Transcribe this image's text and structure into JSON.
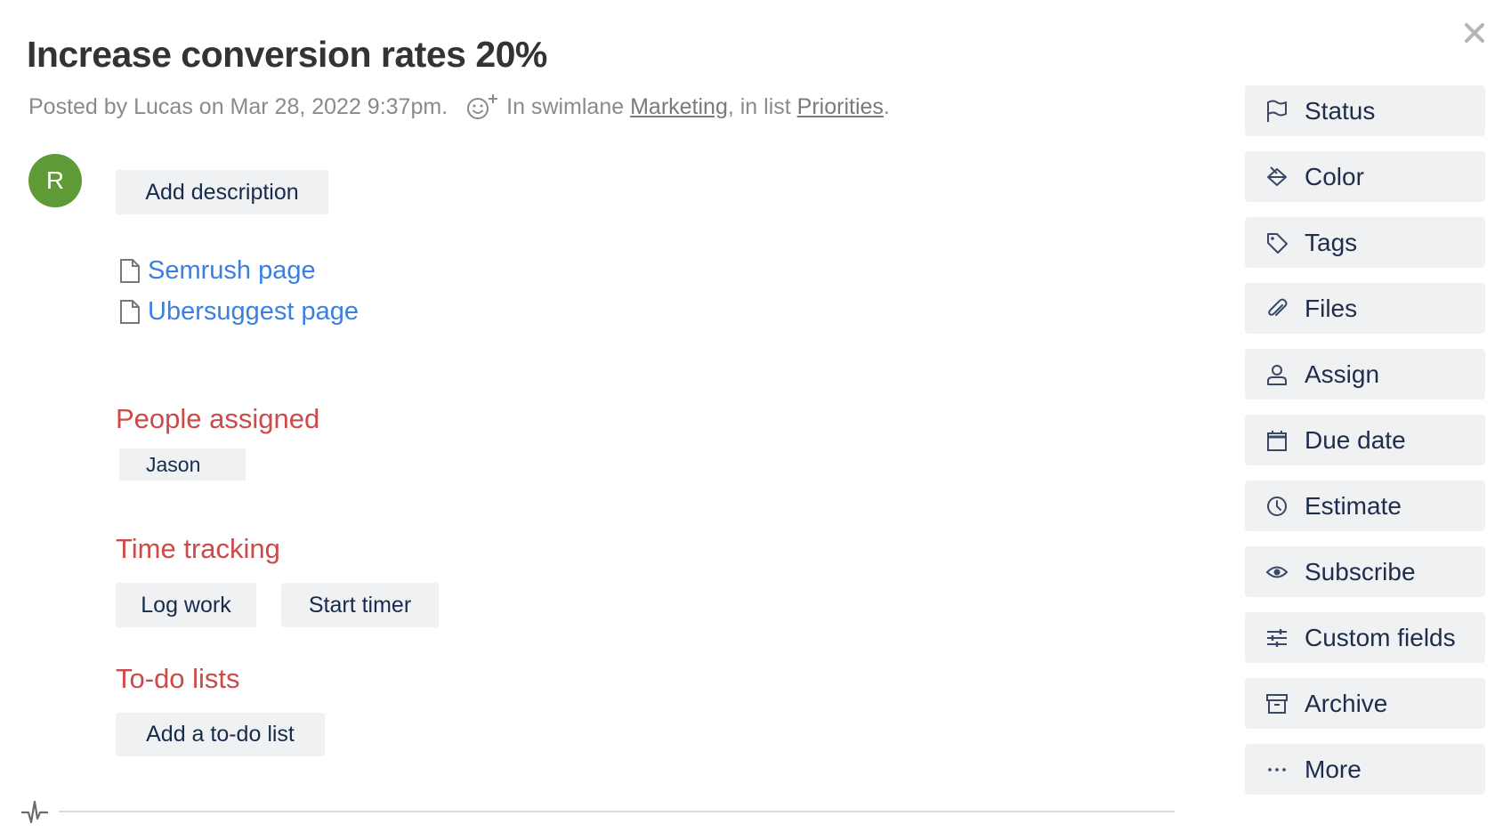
{
  "card": {
    "title": "Increase conversion rates 20%",
    "meta": {
      "posted": "Posted by Lucas on Mar 28, 2022 9:37pm.",
      "in_swimlane": "In swimlane",
      "swimlane": "Marketing",
      "in_list": ", in list",
      "list": "Priorities",
      "end": "."
    },
    "avatar_initial": "R",
    "add_description": "Add description",
    "files": [
      {
        "label": "Semrush page",
        "icon": "file-icon"
      },
      {
        "label": "Ubersuggest page",
        "icon": "file-icon"
      }
    ],
    "people": {
      "heading": "People assigned",
      "assignees": [
        "Jason"
      ]
    },
    "time_tracking": {
      "heading": "Time tracking",
      "log_work": "Log work",
      "start_timer": "Start timer"
    },
    "todo": {
      "heading": "To-do lists",
      "add": "Add a to-do list"
    }
  },
  "sidebar": {
    "items": [
      {
        "label": "Status",
        "icon": "flag-icon"
      },
      {
        "label": "Color",
        "icon": "paint-bucket-icon"
      },
      {
        "label": "Tags",
        "icon": "tag-icon"
      },
      {
        "label": "Files",
        "icon": "paperclip-icon"
      },
      {
        "label": "Assign",
        "icon": "user-icon"
      },
      {
        "label": "Due date",
        "icon": "calendar-icon"
      },
      {
        "label": "Estimate",
        "icon": "clock-icon"
      },
      {
        "label": "Subscribe",
        "icon": "eye-icon"
      },
      {
        "label": "Custom fields",
        "icon": "sliders-icon"
      },
      {
        "label": "Archive",
        "icon": "archive-icon"
      },
      {
        "label": "More",
        "icon": "more-icon"
      }
    ]
  },
  "colors": {
    "section_heading": "#cc4a48",
    "link": "#3b7fe0",
    "avatar": "#5e9a35",
    "button_bg": "#f0f1f3",
    "button_text": "#172b4d"
  }
}
